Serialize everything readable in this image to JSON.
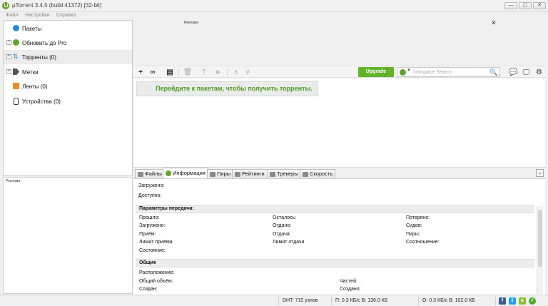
{
  "window": {
    "title": "µTorrent 3.4.5  (build 41372) [32-bit]",
    "minimize_glyph": "—",
    "maximize_glyph": "▢",
    "close_glyph": "✕"
  },
  "menu": [
    "Файл",
    "Настройки",
    "Справка"
  ],
  "sidebar": {
    "items": [
      {
        "label": "Пакеты",
        "icon": "bundle-icon",
        "expandable": false
      },
      {
        "label": "Обновить до Pro",
        "icon": "upgrade-icon",
        "expandable": true
      },
      {
        "label": "Торренты (0)",
        "icon": "torrent-icon",
        "expandable": true
      },
      {
        "label": "Метки",
        "icon": "tag-icon",
        "expandable": true
      },
      {
        "label": "Ленты (0)",
        "icon": "rss-icon",
        "expandable": false
      },
      {
        "label": "Устройства (0)",
        "icon": "device-icon",
        "expandable": false
      }
    ],
    "expand_glyph": "+",
    "selected_index": 2
  },
  "ads": {
    "top_label": "Реклама",
    "top_close": "✕",
    "left_label": "Реклама"
  },
  "toolbar": {
    "upgrade_label": "Upgrade",
    "search_placeholder": "Infospace Search",
    "search_glyph": "🔍",
    "search_caret": "▼",
    "add_glyph": "+",
    "link_glyph": "∞",
    "create_glyph": "▤",
    "remove_glyph": "🗑",
    "start_glyph": "⤒",
    "stop_glyph": "■",
    "up_glyph": "∧",
    "down_glyph": "∨",
    "chat_glyph": "💬",
    "remote_glyph": "🖵",
    "settings_glyph": "⚙"
  },
  "main": {
    "bundles_banner": "Перейдите к пакетам, чтобы получить торренты."
  },
  "tabs": {
    "items": [
      {
        "label": "Файлы"
      },
      {
        "label": "Информация"
      },
      {
        "label": "Пиры"
      },
      {
        "label": "Рейтинги"
      },
      {
        "label": "Трекеры"
      },
      {
        "label": "Скорость"
      }
    ],
    "active_index": 1,
    "collapse_glyph": "⌄"
  },
  "info": {
    "downloaded": "Загружено:",
    "available": "Доступно:",
    "transfer_section": "Параметры передачи:",
    "col1": [
      "Прошло:",
      "Загружено:",
      "Приём:",
      "Лимит приёма",
      "Состояние:"
    ],
    "col2": [
      "Осталось:",
      "Отдано:",
      "Отдача:",
      "Лимит отдачи"
    ],
    "col3": [
      "Потеряно:",
      "Сидов:",
      "Пиры:",
      "Соотношение:"
    ],
    "general_section": "Общие",
    "general_col1": [
      "Расположение:",
      "Общий объём:",
      "Создан:"
    ],
    "general_col2": [
      "",
      "Частей:",
      "Создано:"
    ]
  },
  "status": {
    "dht": "DHT: 715 узлов",
    "download": "П: 0.3 КБ/с В: 136.0 КБ",
    "upload": "О: 0.3 КБ/с В: 102.0 КБ",
    "facebook_glyph": "f",
    "twitter_glyph": "t",
    "android_glyph": "a",
    "ok_glyph": "✓"
  },
  "colors": {
    "accent_green": "#62b32a",
    "banner_text": "#4d9a22"
  }
}
